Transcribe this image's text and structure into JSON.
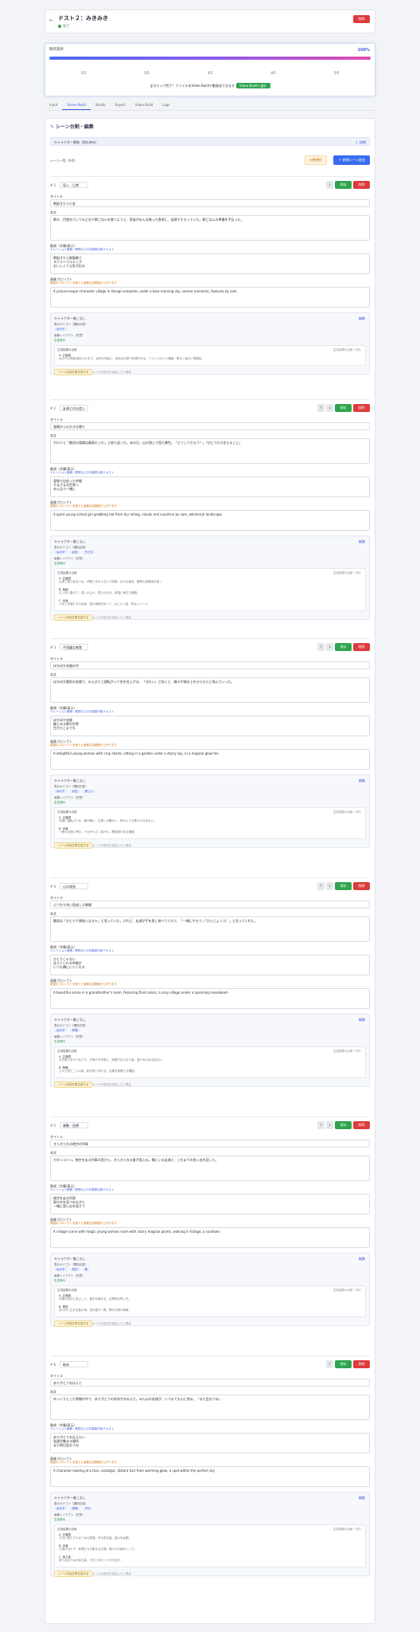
{
  "header": {
    "title": "ドスト２：みきみき",
    "status": "完了",
    "delete": "削除",
    "back": "←"
  },
  "progress": {
    "title": "制作進捗",
    "percent": "100%",
    "steps": [
      "1/5",
      "2/5",
      "3/5",
      "4/5",
      "5/5"
    ],
    "message": "全ステップ完了！ファイルをVideo Buildで動画化できます",
    "button": "Video Buildへ進む"
  },
  "tabs": [
    "Input",
    "Scene Build",
    "Studio",
    "Export",
    "Video Build",
    "Logs"
  ],
  "editor": {
    "title": "シーン台割・編集",
    "profile": "キャラクター情報（保存済み）",
    "profile_action": "＋ 詳細",
    "scene_list": "シーン一覧（6件）",
    "auto_button": "自動整形",
    "add_button": "＋ 新規シーン追加"
  },
  "labels": {
    "title": "タイトル",
    "body": "本文",
    "narration": "歌詞（字幕/表示）",
    "image": "画像プロンプト",
    "save": "保存",
    "delete": "削除",
    "up": "↑",
    "down": "↓",
    "narration_hint": "ナレーション原稿・歌詞などの字幕表示用テキスト",
    "warn": "英語のプロンプトを使うと画像生成精度が上がります"
  },
  "subpanel": {
    "title": "キャラクター着こなし",
    "action": "編集",
    "sub1": "表示カテゴリ（選択必須）",
    "sub2": "画像レイアウト（任意）",
    "ok": "生成済み",
    "view_title": "生成結果の比較",
    "view_right": "生成結果の比較（3件）",
    "ybtn": "シーン内容を再生成する",
    "ynote": "キャラの設定を追加したい場合"
  },
  "scenes": [
    {
      "num": "# 1",
      "emotion": "導入・日常",
      "title": "朝起きたら少女",
      "body": "朝々、目覚めていつもどおり朝ごはんを食べようと、家族がみんな揃った食卓に、笑顔でそろっていた。朝ごはんの準備を手伝った。",
      "narration": "朝起きたら制服着て\nスクランブルエッグ\nおいしくて元気が出る",
      "image": "A picture-esque character village in Yanagi-complete, under a blue morning sky, serene moments, features by sam",
      "chips": [
        "女の子"
      ],
      "views": [
        {
          "label": "A. 正面図",
          "desc": "女の子の笑顔 朝のひだまり、台所を背景に、自然な仕草で料理を作る。バランスのいい構図。明るく温かい雰囲気。"
        }
      ]
    },
    {
      "num": "# 2",
      "emotion": "友達との出会い",
      "title": "冒険からの大きな贈り",
      "body": "ポロリと「最初の冒険は最高だった」と振り返った。あの日、山の頂上で見た景色。「どうしてだろう？」「ひとつだけ言えること」",
      "narration": "冒険で出会った仲間\nさまざまな世界へ\nみんなで一緒に",
      "image": "A quiet young school girl grabbing hat from dry rolling, clouds and sunshine by sam, whimsical landscape",
      "chips": [
        "女の子",
        "女性",
        "子ども"
      ],
      "views": [
        {
          "label": "A. 正面図",
          "desc": "山頂で振り返る少女、仲間と手をつないで笑顔、広がる景色。冒険の高揚感を描く。"
        },
        {
          "label": "B. 側面",
          "desc": "広い空と雲の下、遠くの山々、柔らかな光。希望に満ちた構図。"
        },
        {
          "label": "C. 全身",
          "desc": "少女と仲間たちの全身、旅の道具を持って、はしゃぐ姿。明るいトーン。"
        }
      ]
    },
    {
      "num": "# 3",
      "emotion": "不思議な感覚",
      "title": "ぽかぽか花畑の中",
      "body": "ぽかぽか陽気の花畑で、のんびりと寝転がって空を見上げる。「きれい」と呟くと、蝶々が頭の上をひらひらと飛んでいった。",
      "narration": "ぽかぽか花畑\n蝶とみる夢の世界\n空がどこまでも",
      "image": "A delightful young woman with crop shorts, sitting in a garden under a starry sky, in a magical glow fan",
      "chips": [
        "女の子",
        "女性",
        "美しい"
      ],
      "views": [
        {
          "label": "A. 正面図",
          "desc": "花畑に寝転ぶ少女、蝶が舞い、日差しが暖かい。夢のような柔らかな色合い。"
        },
        {
          "label": "B. 全景",
          "desc": "一面の花畑と青空。少女が小さく描かれ、開放感のある構図。"
        }
      ]
    },
    {
      "num": "# 4",
      "emotion": "心の成長",
      "title": "ぶつかり合い見逃した瞬間",
      "body": "最初は「ひとりで頑張らなきゃ」と思っていた。けれど、友達が手を差し伸べてくれて、「一緒にやろう」「だいじょうぶ！」と言ってくれた。",
      "narration": "ひとりじゃない\n支えてくれる仲間が\nいつも隣にいてくれる",
      "image": "A beautiful scene in a grandmother's room, featuring fluid colors, a cosy village under a sparkling moonbeam",
      "chips": [
        "女の子",
        "仲間"
      ],
      "views": [
        {
          "label": "A. 正面図",
          "desc": "手を取り合う少女たち、夕焼けを背景に、笑顔で支え合う姿。温かみのある色合い。"
        },
        {
          "label": "B. 俯瞰",
          "desc": "上から見た二人の姿、影が長く伸びる。友情を象徴する構図。"
        }
      ]
    },
    {
      "num": "# 5",
      "emotion": "感動・回想",
      "title": "きらきら光る夜空の列車",
      "body": "ガタンゴトン。夜空を走る列車の窓から、きらきら光る星が見える。隣にいる友達と、これまでの思い出を話した。",
      "narration": "夜空を走る列車\n星の光を見つめながら\n一緒に思い出を話そう",
      "image": "A village scene with magic young woman room with starry magical plants, walking in foliage, a sundown",
      "chips": [
        "女の子",
        "夜空",
        "星"
      ],
      "views": [
        {
          "label": "A. 正面図",
          "desc": "列車の窓辺に並ぶ二人、星空を眺める。幻想的な青い光。"
        },
        {
          "label": "B. 車窓",
          "desc": "窓の外に広がる星の海、流れ星が一筋。静かな夜の情景。"
        }
      ]
    },
    {
      "num": "# 6",
      "emotion": "結末",
      "title": "ありがとうを伝えて",
      "body": "ゆっくりとした時間の中で、ありがとうの気持ちを伝えた。みんなの笑顔が、いつまでも心に残る。「また会おうね」",
      "narration": "ありがとうを伝えたい\n笑顔が集まる場所\nまた明日会おうね",
      "image": "A character looking at a tear, nostalgic, distant hair from warming glow, a spot within the perfect sky",
      "chips": [
        "女の子",
        "笑顔",
        "夕日"
      ],
      "views": [
        {
          "label": "A. 正面図",
          "desc": "夕日に照らされる少女の笑顔、手を振る姿。温かな余韻。"
        },
        {
          "label": "B. 全景",
          "desc": "夕焼け空の下、仲間たちが集まる広場。穏やかな締めくくり。"
        },
        {
          "label": "C. 後ろ姿",
          "desc": "振り返る少女の後ろ姿、夕日に向かって歩き出す。"
        }
      ]
    }
  ]
}
